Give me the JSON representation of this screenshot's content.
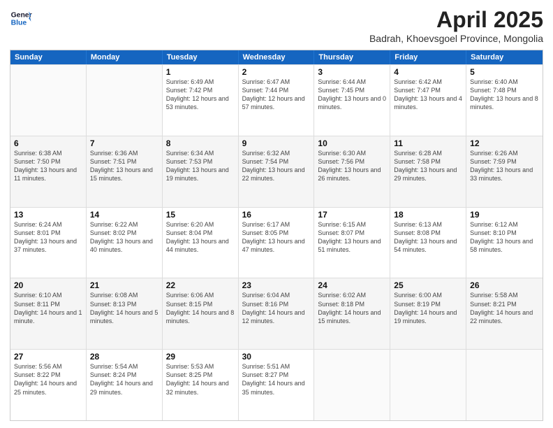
{
  "header": {
    "logo_general": "General",
    "logo_blue": "Blue",
    "title": "April 2025",
    "location": "Badrah, Khoevsgoel Province, Mongolia"
  },
  "days_of_week": [
    "Sunday",
    "Monday",
    "Tuesday",
    "Wednesday",
    "Thursday",
    "Friday",
    "Saturday"
  ],
  "weeks": [
    [
      {
        "day": "",
        "sunrise": "",
        "sunset": "",
        "daylight": "",
        "empty": true
      },
      {
        "day": "",
        "sunrise": "",
        "sunset": "",
        "daylight": "",
        "empty": true
      },
      {
        "day": "1",
        "sunrise": "Sunrise: 6:49 AM",
        "sunset": "Sunset: 7:42 PM",
        "daylight": "Daylight: 12 hours and 53 minutes.",
        "empty": false
      },
      {
        "day": "2",
        "sunrise": "Sunrise: 6:47 AM",
        "sunset": "Sunset: 7:44 PM",
        "daylight": "Daylight: 12 hours and 57 minutes.",
        "empty": false
      },
      {
        "day": "3",
        "sunrise": "Sunrise: 6:44 AM",
        "sunset": "Sunset: 7:45 PM",
        "daylight": "Daylight: 13 hours and 0 minutes.",
        "empty": false
      },
      {
        "day": "4",
        "sunrise": "Sunrise: 6:42 AM",
        "sunset": "Sunset: 7:47 PM",
        "daylight": "Daylight: 13 hours and 4 minutes.",
        "empty": false
      },
      {
        "day": "5",
        "sunrise": "Sunrise: 6:40 AM",
        "sunset": "Sunset: 7:48 PM",
        "daylight": "Daylight: 13 hours and 8 minutes.",
        "empty": false
      }
    ],
    [
      {
        "day": "6",
        "sunrise": "Sunrise: 6:38 AM",
        "sunset": "Sunset: 7:50 PM",
        "daylight": "Daylight: 13 hours and 11 minutes.",
        "empty": false
      },
      {
        "day": "7",
        "sunrise": "Sunrise: 6:36 AM",
        "sunset": "Sunset: 7:51 PM",
        "daylight": "Daylight: 13 hours and 15 minutes.",
        "empty": false
      },
      {
        "day": "8",
        "sunrise": "Sunrise: 6:34 AM",
        "sunset": "Sunset: 7:53 PM",
        "daylight": "Daylight: 13 hours and 19 minutes.",
        "empty": false
      },
      {
        "day": "9",
        "sunrise": "Sunrise: 6:32 AM",
        "sunset": "Sunset: 7:54 PM",
        "daylight": "Daylight: 13 hours and 22 minutes.",
        "empty": false
      },
      {
        "day": "10",
        "sunrise": "Sunrise: 6:30 AM",
        "sunset": "Sunset: 7:56 PM",
        "daylight": "Daylight: 13 hours and 26 minutes.",
        "empty": false
      },
      {
        "day": "11",
        "sunrise": "Sunrise: 6:28 AM",
        "sunset": "Sunset: 7:58 PM",
        "daylight": "Daylight: 13 hours and 29 minutes.",
        "empty": false
      },
      {
        "day": "12",
        "sunrise": "Sunrise: 6:26 AM",
        "sunset": "Sunset: 7:59 PM",
        "daylight": "Daylight: 13 hours and 33 minutes.",
        "empty": false
      }
    ],
    [
      {
        "day": "13",
        "sunrise": "Sunrise: 6:24 AM",
        "sunset": "Sunset: 8:01 PM",
        "daylight": "Daylight: 13 hours and 37 minutes.",
        "empty": false
      },
      {
        "day": "14",
        "sunrise": "Sunrise: 6:22 AM",
        "sunset": "Sunset: 8:02 PM",
        "daylight": "Daylight: 13 hours and 40 minutes.",
        "empty": false
      },
      {
        "day": "15",
        "sunrise": "Sunrise: 6:20 AM",
        "sunset": "Sunset: 8:04 PM",
        "daylight": "Daylight: 13 hours and 44 minutes.",
        "empty": false
      },
      {
        "day": "16",
        "sunrise": "Sunrise: 6:17 AM",
        "sunset": "Sunset: 8:05 PM",
        "daylight": "Daylight: 13 hours and 47 minutes.",
        "empty": false
      },
      {
        "day": "17",
        "sunrise": "Sunrise: 6:15 AM",
        "sunset": "Sunset: 8:07 PM",
        "daylight": "Daylight: 13 hours and 51 minutes.",
        "empty": false
      },
      {
        "day": "18",
        "sunrise": "Sunrise: 6:13 AM",
        "sunset": "Sunset: 8:08 PM",
        "daylight": "Daylight: 13 hours and 54 minutes.",
        "empty": false
      },
      {
        "day": "19",
        "sunrise": "Sunrise: 6:12 AM",
        "sunset": "Sunset: 8:10 PM",
        "daylight": "Daylight: 13 hours and 58 minutes.",
        "empty": false
      }
    ],
    [
      {
        "day": "20",
        "sunrise": "Sunrise: 6:10 AM",
        "sunset": "Sunset: 8:11 PM",
        "daylight": "Daylight: 14 hours and 1 minute.",
        "empty": false
      },
      {
        "day": "21",
        "sunrise": "Sunrise: 6:08 AM",
        "sunset": "Sunset: 8:13 PM",
        "daylight": "Daylight: 14 hours and 5 minutes.",
        "empty": false
      },
      {
        "day": "22",
        "sunrise": "Sunrise: 6:06 AM",
        "sunset": "Sunset: 8:15 PM",
        "daylight": "Daylight: 14 hours and 8 minutes.",
        "empty": false
      },
      {
        "day": "23",
        "sunrise": "Sunrise: 6:04 AM",
        "sunset": "Sunset: 8:16 PM",
        "daylight": "Daylight: 14 hours and 12 minutes.",
        "empty": false
      },
      {
        "day": "24",
        "sunrise": "Sunrise: 6:02 AM",
        "sunset": "Sunset: 8:18 PM",
        "daylight": "Daylight: 14 hours and 15 minutes.",
        "empty": false
      },
      {
        "day": "25",
        "sunrise": "Sunrise: 6:00 AM",
        "sunset": "Sunset: 8:19 PM",
        "daylight": "Daylight: 14 hours and 19 minutes.",
        "empty": false
      },
      {
        "day": "26",
        "sunrise": "Sunrise: 5:58 AM",
        "sunset": "Sunset: 8:21 PM",
        "daylight": "Daylight: 14 hours and 22 minutes.",
        "empty": false
      }
    ],
    [
      {
        "day": "27",
        "sunrise": "Sunrise: 5:56 AM",
        "sunset": "Sunset: 8:22 PM",
        "daylight": "Daylight: 14 hours and 25 minutes.",
        "empty": false
      },
      {
        "day": "28",
        "sunrise": "Sunrise: 5:54 AM",
        "sunset": "Sunset: 8:24 PM",
        "daylight": "Daylight: 14 hours and 29 minutes.",
        "empty": false
      },
      {
        "day": "29",
        "sunrise": "Sunrise: 5:53 AM",
        "sunset": "Sunset: 8:25 PM",
        "daylight": "Daylight: 14 hours and 32 minutes.",
        "empty": false
      },
      {
        "day": "30",
        "sunrise": "Sunrise: 5:51 AM",
        "sunset": "Sunset: 8:27 PM",
        "daylight": "Daylight: 14 hours and 35 minutes.",
        "empty": false
      },
      {
        "day": "",
        "sunrise": "",
        "sunset": "",
        "daylight": "",
        "empty": true
      },
      {
        "day": "",
        "sunrise": "",
        "sunset": "",
        "daylight": "",
        "empty": true
      },
      {
        "day": "",
        "sunrise": "",
        "sunset": "",
        "daylight": "",
        "empty": true
      }
    ]
  ]
}
